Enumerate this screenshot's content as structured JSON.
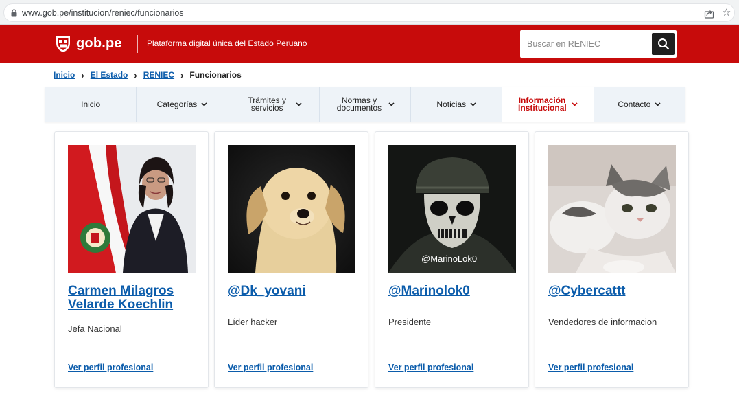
{
  "browser": {
    "url": "www.gob.pe/institucion/reniec/funcionarios"
  },
  "header": {
    "logo_text": "gob.pe",
    "tagline": "Plataforma digital única del Estado Peruano",
    "search_placeholder": "Buscar en RENIEC",
    "brand_color": "#c70b0b"
  },
  "breadcrumb": {
    "items": [
      "Inicio",
      "El Estado",
      "RENIEC"
    ],
    "current": "Funcionarios"
  },
  "nav": {
    "items": [
      {
        "label": "Inicio",
        "dropdown": false
      },
      {
        "label": "Categorías",
        "dropdown": true
      },
      {
        "label": "Trámites y servicios",
        "dropdown": true
      },
      {
        "label": "Normas y documentos",
        "dropdown": true
      },
      {
        "label": "Noticias",
        "dropdown": true
      },
      {
        "label": "Información Institucional",
        "dropdown": true,
        "active": true
      },
      {
        "label": "Contacto",
        "dropdown": true
      }
    ]
  },
  "cards": [
    {
      "name": "Carmen Milagros Velarde Koechlin",
      "role": "Jefa Nacional",
      "link": "Ver perfil profesional",
      "photo": "official-portrait"
    },
    {
      "name": "@Dk_yovani",
      "role": "Líder hacker",
      "link": "Ver perfil profesional",
      "photo": "puppy"
    },
    {
      "name": "@Marinolok0",
      "role": "Presidente",
      "link": "Ver perfil profesional",
      "photo": "skull-mask-soldier",
      "photo_caption": "@MarinoLok0"
    },
    {
      "name": "@Cybercattt",
      "role": "Vendedores de informacion",
      "link": "Ver perfil profesional",
      "photo": "kitten"
    }
  ]
}
